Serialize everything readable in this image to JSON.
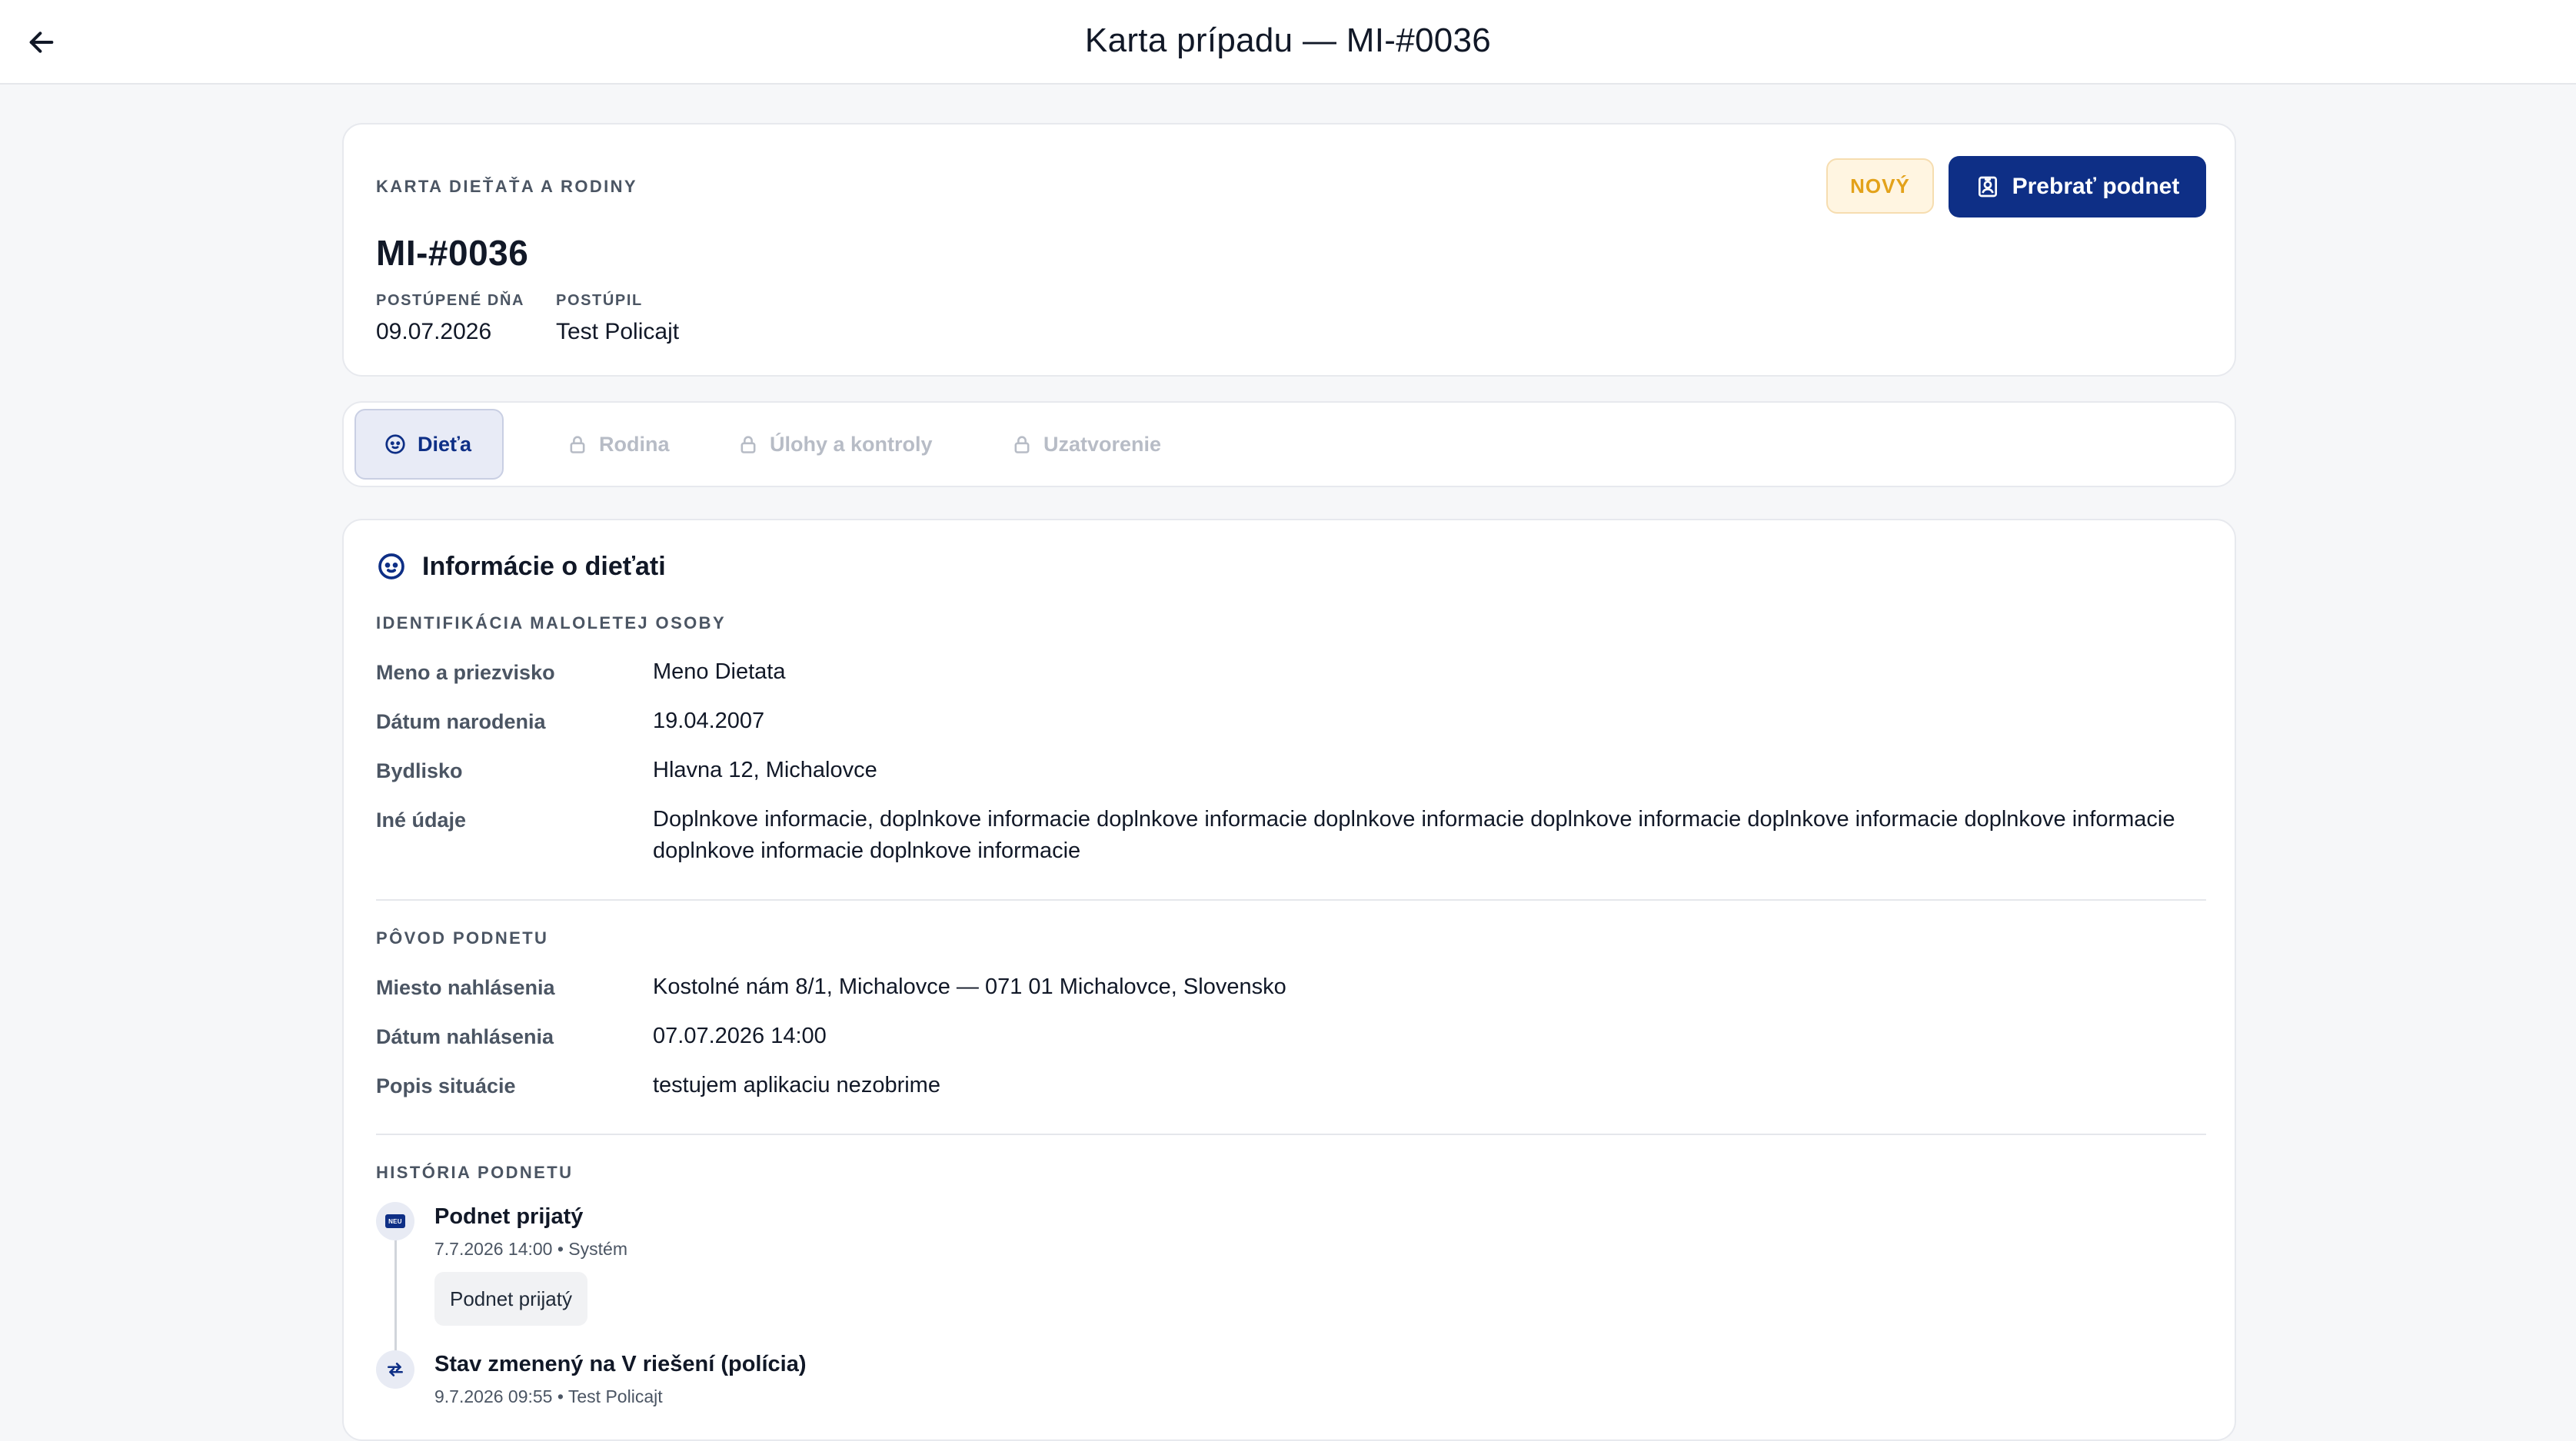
{
  "topbar": {
    "title": "Karta prípadu — MI-#0036",
    "back_icon": "arrow-left-icon"
  },
  "header": {
    "eyebrow": "KARTA DIEŤAŤA A RODINY",
    "case_id": "MI-#0036",
    "meta": [
      {
        "label": "POSTÚPENÉ DŇA",
        "value": "09.07.2026"
      },
      {
        "label": "POSTÚPIL",
        "value": "Test Policajt"
      }
    ],
    "status_badge": "NOVÝ",
    "take_over_label": "Prebrať podnet",
    "colors": {
      "primary": "#0e2f86",
      "badge_text": "#e3a21a",
      "badge_bg": "#fff5e1"
    }
  },
  "tabs": [
    {
      "label": "Dieťa",
      "icon": "child-face-icon",
      "active": true
    },
    {
      "label": "Rodina",
      "icon": "lock-icon",
      "active": false
    },
    {
      "label": "Úlohy a kontroly",
      "icon": "lock-icon",
      "active": false
    },
    {
      "label": "Uzatvorenie",
      "icon": "lock-icon",
      "active": false
    }
  ],
  "main": {
    "title": "Informácie o dieťati",
    "identification": {
      "heading": "IDENTIFIKÁCIA MALOLETEJ OSOBY",
      "rows": [
        {
          "label": "Meno a priezvisko",
          "value": "Meno Dietata"
        },
        {
          "label": "Dátum narodenia",
          "value": "19.04.2007"
        },
        {
          "label": "Bydlisko",
          "value": "Hlavna 12, Michalovce"
        },
        {
          "label": "Iné údaje",
          "value": "Doplnkove informacie, doplnkove informacie doplnkove informacie doplnkove informacie doplnkove informacie doplnkove informacie doplnkove informacie doplnkove informacie doplnkove informacie"
        }
      ]
    },
    "origin": {
      "heading": "PÔVOD PODNETU",
      "rows": [
        {
          "label": "Miesto nahlásenia",
          "value": "Kostolné nám 8/1, Michalovce — 071 01 Michalovce, Slovensko"
        },
        {
          "label": "Dátum nahlásenia",
          "value": "07.07.2026 14:00"
        },
        {
          "label": "Popis situácie",
          "value": "testujem aplikaciu nezobrime"
        }
      ]
    },
    "history": {
      "heading": "HISTÓRIA PODNETU",
      "events": [
        {
          "title": "Podnet prijatý",
          "meta": "7.7.2026 14:00 • Systém",
          "note": "Podnet prijatý",
          "icon": "new-badge-icon",
          "icon_text": "NEU"
        },
        {
          "title": "Stav zmenený na V riešení (polícia)",
          "meta": "9.7.2026 09:55 • Test Policajt",
          "icon": "swap-arrows-icon"
        }
      ]
    }
  }
}
